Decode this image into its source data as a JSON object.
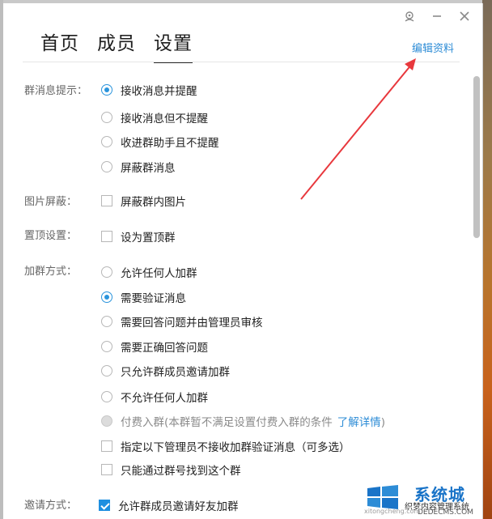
{
  "tabs": [
    {
      "label": "首页"
    },
    {
      "label": "成员"
    },
    {
      "label": "设置"
    }
  ],
  "header": {
    "edit_profile": "编辑资料"
  },
  "sections": {
    "msg_notify": {
      "label": "群消息提示：",
      "options": [
        "接收消息并提醒",
        "接收消息但不提醒",
        "收进群助手且不提醒",
        "屏蔽群消息"
      ],
      "selected_index": 0
    },
    "image_block": {
      "label": "图片屏蔽：",
      "option": "屏蔽群内图片",
      "checked": false
    },
    "pin": {
      "label": "置顶设置：",
      "option": "设为置顶群",
      "checked": false
    },
    "join_method": {
      "label": "加群方式：",
      "options": [
        "允许任何人加群",
        "需要验证消息",
        "需要回答问题并由管理员审核",
        "需要正确回答问题",
        "只允许群成员邀请加群",
        "不允许任何人加群"
      ],
      "selected_index": 1,
      "paid_option": "付费入群(本群暂不满足设置付费入群的条件",
      "paid_link": "了解详情",
      "paid_close": ")",
      "check_admin": "指定以下管理员不接收加群验证消息（可多选）",
      "check_number_only": "只能通过群号找到这个群"
    },
    "invite": {
      "label": "邀请方式：",
      "option": "允许群成员邀请好友加群",
      "checked": true
    }
  },
  "watermark": {
    "brand": "系统城",
    "sub": "织梦内容管理系统",
    "site": "DEDECMS.COM",
    "url": "xitongcheng.com"
  },
  "colors": {
    "accent": "#2a94dc",
    "link": "#2d8cd6",
    "arrow": "#e8383d"
  }
}
